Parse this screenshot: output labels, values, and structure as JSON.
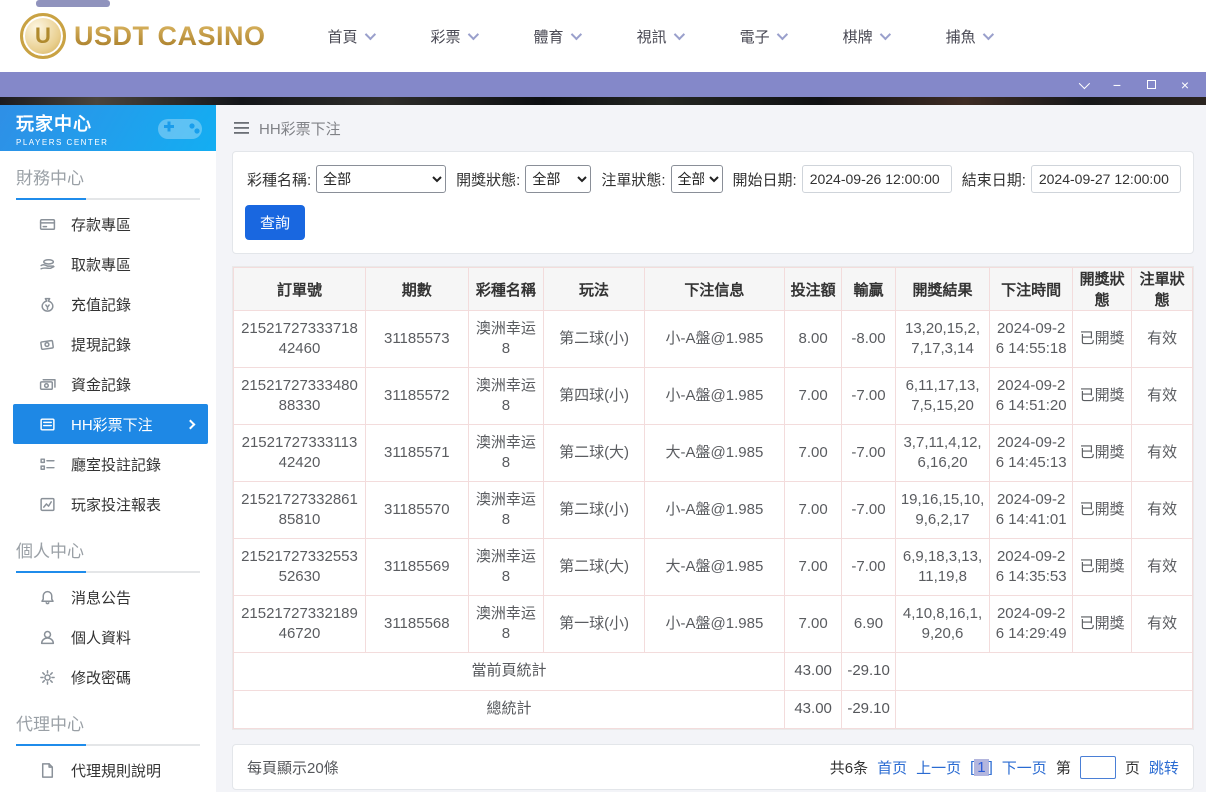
{
  "topnav": {
    "brand": "USDT CASINO",
    "items": [
      {
        "label": "首頁"
      },
      {
        "label": "彩票"
      },
      {
        "label": "體育"
      },
      {
        "label": "視訊"
      },
      {
        "label": "電子"
      },
      {
        "label": "棋牌"
      },
      {
        "label": "捕魚"
      }
    ]
  },
  "window_controls": {
    "collapse": "collapse",
    "minimize": "−",
    "maximize": "maximize",
    "close": "×"
  },
  "sidebar": {
    "title": "玩家中心",
    "subtitle": "PLAYERS CENTER",
    "sections": [
      {
        "title": "財務中心",
        "items": [
          {
            "label": "存款專區",
            "icon": "deposit-icon",
            "active": false
          },
          {
            "label": "取款專區",
            "icon": "withdraw-icon",
            "active": false
          },
          {
            "label": "充值記錄",
            "icon": "recharge-record-icon",
            "active": false
          },
          {
            "label": "提現記錄",
            "icon": "withdrawal-record-icon",
            "active": false
          },
          {
            "label": "資金記錄",
            "icon": "funds-record-icon",
            "active": false
          },
          {
            "label": "HH彩票下注",
            "icon": "lottery-bet-icon",
            "active": true
          },
          {
            "label": "廳室投註記錄",
            "icon": "hall-record-icon",
            "active": false
          },
          {
            "label": "玩家投注報表",
            "icon": "report-icon",
            "active": false
          }
        ]
      },
      {
        "title": "個人中心",
        "items": [
          {
            "label": "消息公告",
            "icon": "bell-icon",
            "active": false
          },
          {
            "label": "個人資料",
            "icon": "person-icon",
            "active": false
          },
          {
            "label": "修改密碼",
            "icon": "gear-icon",
            "active": false
          }
        ]
      },
      {
        "title": "代理中心",
        "items": [
          {
            "label": "代理規則說明",
            "icon": "document-icon",
            "active": false
          }
        ]
      }
    ]
  },
  "breadcrumb": {
    "title": "HH彩票下注"
  },
  "filters": {
    "lottery_label": "彩種名稱:",
    "lottery_value": "全部",
    "draw_status_label": "開獎狀態:",
    "draw_status_value": "全部",
    "order_status_label": "注單狀態:",
    "order_status_value": "全部",
    "start_label": "開始日期:",
    "start_value": "2024-09-26 12:00:00",
    "end_label": "結束日期:",
    "end_value": "2024-09-27 12:00:00",
    "search_label": "查詢"
  },
  "table": {
    "columns": [
      "訂單號",
      "期數",
      "彩種名稱",
      "玩法",
      "下注信息",
      "投注額",
      "輸贏",
      "開獎結果",
      "下注時間",
      "開獎狀態",
      "注單狀態"
    ],
    "rows": [
      [
        "2152172733371842460",
        "31185573",
        "澳洲幸运8",
        "第二球(小)",
        "小-A盤@1.985",
        "8.00",
        "-8.00",
        "13,20,15,2,7,17,3,14",
        "2024-09-26 14:55:18",
        "已開獎",
        "有效"
      ],
      [
        "2152172733348088330",
        "31185572",
        "澳洲幸运8",
        "第四球(小)",
        "小-A盤@1.985",
        "7.00",
        "-7.00",
        "6,11,17,13,7,5,15,20",
        "2024-09-26 14:51:20",
        "已開獎",
        "有效"
      ],
      [
        "2152172733311342420",
        "31185571",
        "澳洲幸运8",
        "第二球(大)",
        "大-A盤@1.985",
        "7.00",
        "-7.00",
        "3,7,11,4,12,6,16,20",
        "2024-09-26 14:45:13",
        "已開獎",
        "有效"
      ],
      [
        "2152172733286185810",
        "31185570",
        "澳洲幸运8",
        "第二球(小)",
        "小-A盤@1.985",
        "7.00",
        "-7.00",
        "19,16,15,10,9,6,2,17",
        "2024-09-26 14:41:01",
        "已開獎",
        "有效"
      ],
      [
        "2152172733255352630",
        "31185569",
        "澳洲幸运8",
        "第二球(大)",
        "大-A盤@1.985",
        "7.00",
        "-7.00",
        "6,9,18,3,13,11,19,8",
        "2024-09-26 14:35:53",
        "已開獎",
        "有效"
      ],
      [
        "2152172733218946720",
        "31185568",
        "澳洲幸运8",
        "第一球(小)",
        "小-A盤@1.985",
        "7.00",
        "6.90",
        "4,10,8,16,1,9,20,6",
        "2024-09-26 14:29:49",
        "已開獎",
        "有效"
      ]
    ],
    "summary_rows": [
      {
        "label": "當前頁統計",
        "bet": "43.00",
        "winloss": "-29.10"
      },
      {
        "label": "總統計",
        "bet": "43.00",
        "winloss": "-29.10"
      }
    ]
  },
  "footer": {
    "page_size": "每頁顯示20條",
    "total": "共6条",
    "first": "首页",
    "prev": "上一页",
    "current": "1",
    "next": "下一页",
    "jump_prefix": "第",
    "jump_suffix": "页",
    "jump": "跳转"
  },
  "colors": {
    "titlebar_purple": "#8488c9",
    "sidebar_blue_start": "#2f8fe6",
    "sidebar_blue_end": "#13aef2",
    "active_blue": "#1e88e5",
    "query_blue": "#1967e0",
    "link_blue": "#2a6bd2",
    "brand_gold": "#b8923f",
    "table_border_pink": "#f3dcdc",
    "current_page_bg": "#b3b6de"
  }
}
